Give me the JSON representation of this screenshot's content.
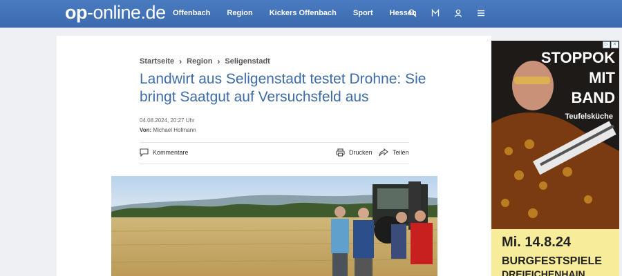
{
  "header": {
    "logo_bold": "op",
    "logo_rest": "-online.de",
    "nav": [
      "Offenbach",
      "Region",
      "Kickers Offenbach",
      "Sport",
      "Hessen"
    ],
    "icons": [
      "search-icon",
      "merkliste-icon",
      "user-icon",
      "menu-icon"
    ]
  },
  "breadcrumb": [
    "Startseite",
    "Region",
    "Seligenstadt"
  ],
  "article": {
    "headline": "Landwirt aus Seligenstadt testet Drohne: Sie bringt Saatgut auf Versuchsfeld aus",
    "date": "04.08.2024, 20:27 Uhr",
    "by_label": "Von:",
    "author": "Michael Hofmann",
    "actions": {
      "comments": "Kommentare",
      "print": "Drucken",
      "share": "Teilen"
    }
  },
  "ad": {
    "line1": "STOPPOK",
    "line2": "MIT",
    "line3": "BAND",
    "sub": "Teufelsküche",
    "date": "Mi. 14.8.24",
    "event": "BURGFESTSPIELE",
    "location": "DREIEICHENHAIN"
  },
  "colors": {
    "header_blue": "#3f70b5",
    "headline_blue": "#3d6ca8",
    "ad_yellow": "#f7ec9a"
  }
}
